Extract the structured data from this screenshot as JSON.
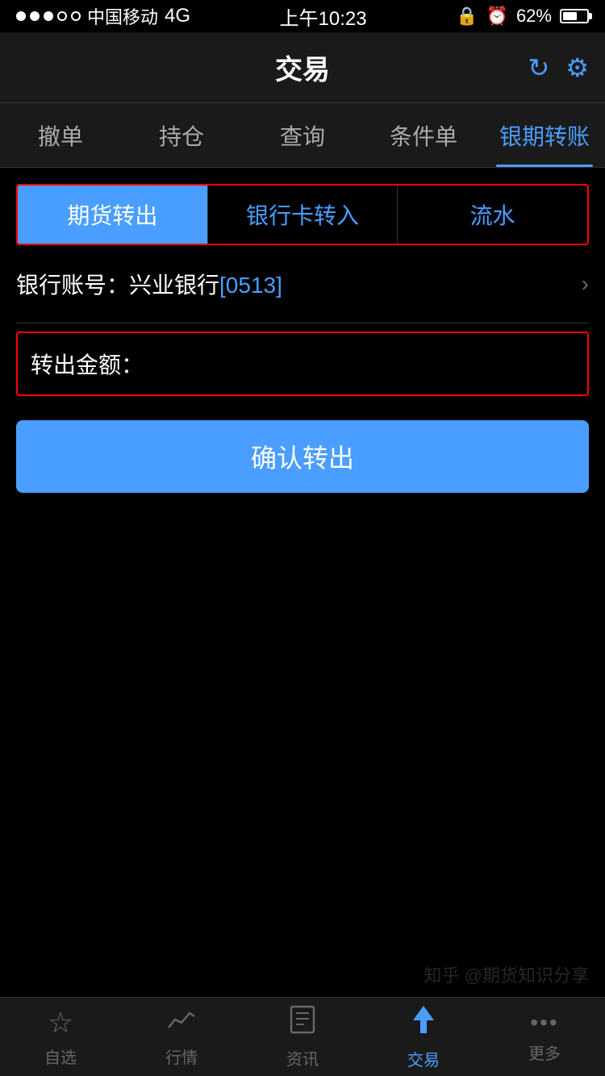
{
  "status_bar": {
    "carrier": "中国移动",
    "network": "4G",
    "time": "上午10:23",
    "battery": "62%"
  },
  "header": {
    "title": "交易",
    "refresh_label": "refresh",
    "settings_label": "settings"
  },
  "nav_tabs": [
    {
      "id": "cancel",
      "label": "撤单",
      "active": false
    },
    {
      "id": "position",
      "label": "持仓",
      "active": false
    },
    {
      "id": "query",
      "label": "查询",
      "active": false
    },
    {
      "id": "condition",
      "label": "条件单",
      "active": false
    },
    {
      "id": "transfer",
      "label": "银期转账",
      "active": true
    }
  ],
  "sub_tabs": [
    {
      "id": "futures-out",
      "label": "期货转出",
      "active": true
    },
    {
      "id": "bank-in",
      "label": "银行卡转入",
      "active": false
    },
    {
      "id": "flow",
      "label": "流水",
      "active": false
    }
  ],
  "bank_account": {
    "label": "银行账号：兴业银行",
    "highlight": "[0513]"
  },
  "amount_field": {
    "label": "转出金额：",
    "placeholder": ""
  },
  "confirm_button": {
    "label": "确认转出"
  },
  "bottom_tabs": [
    {
      "id": "favorites",
      "label": "自选",
      "icon": "☆",
      "active": false
    },
    {
      "id": "market",
      "label": "行情",
      "icon": "📈",
      "active": false
    },
    {
      "id": "news",
      "label": "资讯",
      "icon": "📄",
      "active": false
    },
    {
      "id": "trade",
      "label": "交易",
      "icon": "⚡",
      "active": true
    },
    {
      "id": "more",
      "label": "更多",
      "icon": "···",
      "active": false
    }
  ],
  "watermark": "知乎 @期货知识分享"
}
